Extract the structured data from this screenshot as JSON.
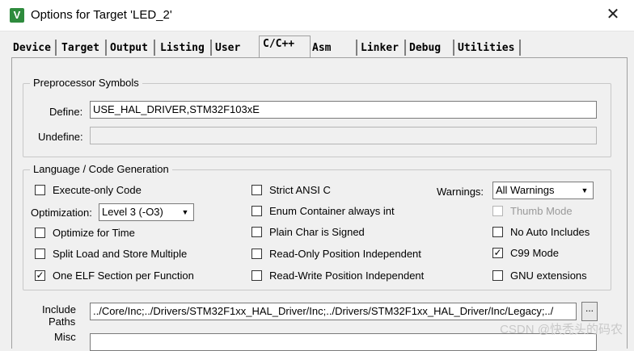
{
  "window": {
    "title": "Options for Target 'LED_2'"
  },
  "tabs": [
    {
      "label": "Device"
    },
    {
      "label": "Target"
    },
    {
      "label": "Output"
    },
    {
      "label": "Listing"
    },
    {
      "label": "User"
    },
    {
      "label": "C/C++"
    },
    {
      "label": "Asm"
    },
    {
      "label": "Linker"
    },
    {
      "label": "Debug"
    },
    {
      "label": "Utilities"
    }
  ],
  "preprocessor": {
    "group_title": "Preprocessor Symbols",
    "define_label": "Define:",
    "define_value": "USE_HAL_DRIVER,STM32F103xE",
    "undefine_label": "Undefine:",
    "undefine_value": ""
  },
  "language": {
    "group_title": "Language / Code Generation",
    "execute_only": {
      "label": "Execute-only Code",
      "checked": false
    },
    "optimization_label": "Optimization:",
    "optimization_value": "Level 3 (-O3)",
    "optimize_time": {
      "label": "Optimize for Time",
      "checked": false
    },
    "split_load": {
      "label": "Split Load and Store Multiple",
      "checked": false
    },
    "one_elf": {
      "label": "One ELF Section per Function",
      "checked": true
    },
    "strict_ansi": {
      "label": "Strict ANSI C",
      "checked": false
    },
    "enum_container": {
      "label": "Enum Container always int",
      "checked": false
    },
    "plain_char": {
      "label": "Plain Char is Signed",
      "checked": false
    },
    "ro_pos": {
      "label": "Read-Only Position Independent",
      "checked": false
    },
    "rw_pos": {
      "label": "Read-Write Position Independent",
      "checked": false
    },
    "warnings_label": "Warnings:",
    "warnings_value": "All Warnings",
    "thumb_mode": {
      "label": "Thumb Mode",
      "checked": false
    },
    "no_auto_includes": {
      "label": "No Auto Includes",
      "checked": false
    },
    "c99_mode": {
      "label": "C99 Mode",
      "checked": true
    },
    "gnu_ext": {
      "label": "GNU extensions",
      "checked": false
    }
  },
  "include": {
    "label_line1": "Include",
    "label_line2": "Paths",
    "value": "../Core/Inc;../Drivers/STM32F1xx_HAL_Driver/Inc;../Drivers/STM32F1xx_HAL_Driver/Inc/Legacy;../",
    "browse_label": "..."
  },
  "misc": {
    "label": "Misc"
  },
  "watermark": "CSDN @快秃头的码农",
  "icons": {
    "app": "keil-icon",
    "close": "close-icon"
  }
}
